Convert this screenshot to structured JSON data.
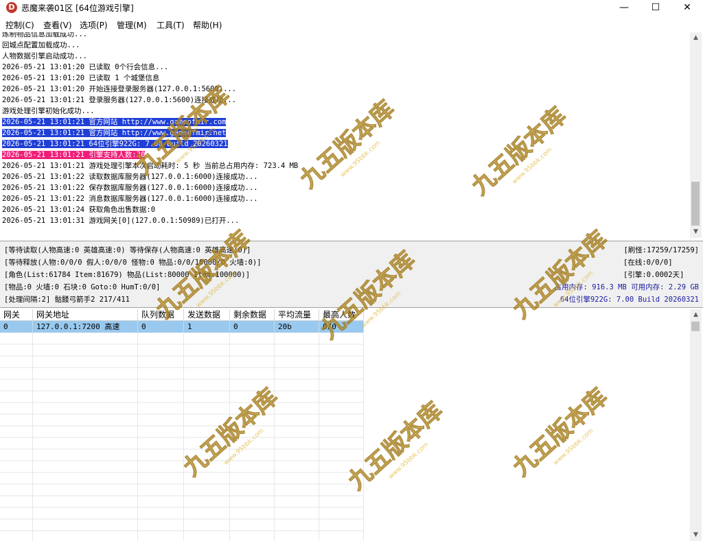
{
  "window": {
    "icon_letter": "D",
    "title": "恶魔来袭01区 [64位游戏引擎]",
    "min_symbol": "—",
    "max_symbol": "☐",
    "close_symbol": "✕"
  },
  "menu": [
    "控制(C)",
    "查看(V)",
    "选项(P)",
    "管理(M)",
    "工具(T)",
    "帮助(H)"
  ],
  "log": [
    {
      "text": "炼制物品信息加载成功...",
      "hl": ""
    },
    {
      "text": "回城点配置加载成功...",
      "hl": ""
    },
    {
      "text": "人物数据引擎启动成功...",
      "hl": ""
    },
    {
      "text": "2026-05-21 13:01:20 已读取 0个行会信息...",
      "hl": ""
    },
    {
      "text": "2026-05-21 13:01:20 已读取 1 个城堡信息",
      "hl": ""
    },
    {
      "text": "2026-05-21 13:01:20 开始连接登录服务器(127.0.0.1:5600)...",
      "hl": ""
    },
    {
      "text": "2026-05-21 13:01:21 登录服务器(127.0.0.1:5600)连接成功...",
      "hl": ""
    },
    {
      "text": "游戏处理引擎初始化成功...",
      "hl": ""
    },
    {
      "text": "2026-05-21 13:01:21 官方网站 http://www.gameofmir.com",
      "hl": "blue"
    },
    {
      "text": "2026-05-21 13:01:21 官方网站 http://www.gameofmir.net",
      "hl": "blue"
    },
    {
      "text": "2026-05-21 13:01:21 64位引擎922G: 7.00 Build 20260321",
      "hl": "blue"
    },
    {
      "text": "2026-05-21 13:01:21 引擎支持人数:30",
      "hl": "pink"
    },
    {
      "text": "2026-05-21 13:01:21 游戏处理引擎本次启动耗时: 5 秒 当前总占用内存: 723.4 MB",
      "hl": ""
    },
    {
      "text": "2026-05-21 13:01:22 读取数据库服务器(127.0.0.1:6000)连接成功...",
      "hl": ""
    },
    {
      "text": "2026-05-21 13:01:22 保存数据库服务器(127.0.0.1:6000)连接成功...",
      "hl": ""
    },
    {
      "text": "2026-05-21 13:01:22 消息数据库服务器(127.0.0.1:6000)连接成功...",
      "hl": ""
    },
    {
      "text": "2026-05-21 13:01:24 获取角色出售数据:0",
      "hl": ""
    },
    {
      "text": "2026-05-21 13:01:31 游戏网关[0](127.0.0.1:50989)已打开...",
      "hl": ""
    }
  ],
  "status": {
    "left": [
      "[等待读取(人物高速:0 英雄高速:0) 等待保存(人物高速:0 英雄高速:0)]",
      "[等待释放(人物:0/0/0 假人:0/0/0 怪物:0 物品:0/0/10000/0 火墙:0)]",
      "[角色(List:61784 Item:81679) 物品(List:80000 Item:100000)]",
      "[物品:0 火墙:0 石块:0 Goto:0 HumT:0/0]",
      "[处理间隔:2]   骷髅弓箭手2 217/411"
    ],
    "right": [
      "[刷怪:17259/17259]",
      "[在线:0/0/0]",
      "[引擎:0.0002天]"
    ],
    "memory": "占用内存: 916.3 MB 可用内存: 2.29 GB",
    "version": "64位引擎922G: 7.00 Build 20260321"
  },
  "grid": {
    "headers": [
      "网关",
      "网关地址",
      "队列数据",
      "发送数据",
      "剩余数据",
      "平均流量",
      "最高人数"
    ],
    "rows": [
      [
        "0",
        "127.0.0.1:7200 高速",
        "0",
        "1",
        "0",
        "20b",
        "0/0"
      ]
    ]
  },
  "watermark": {
    "text": "九五版本库",
    "sub": "www.95bbk.com",
    "color": "#e0b840"
  }
}
